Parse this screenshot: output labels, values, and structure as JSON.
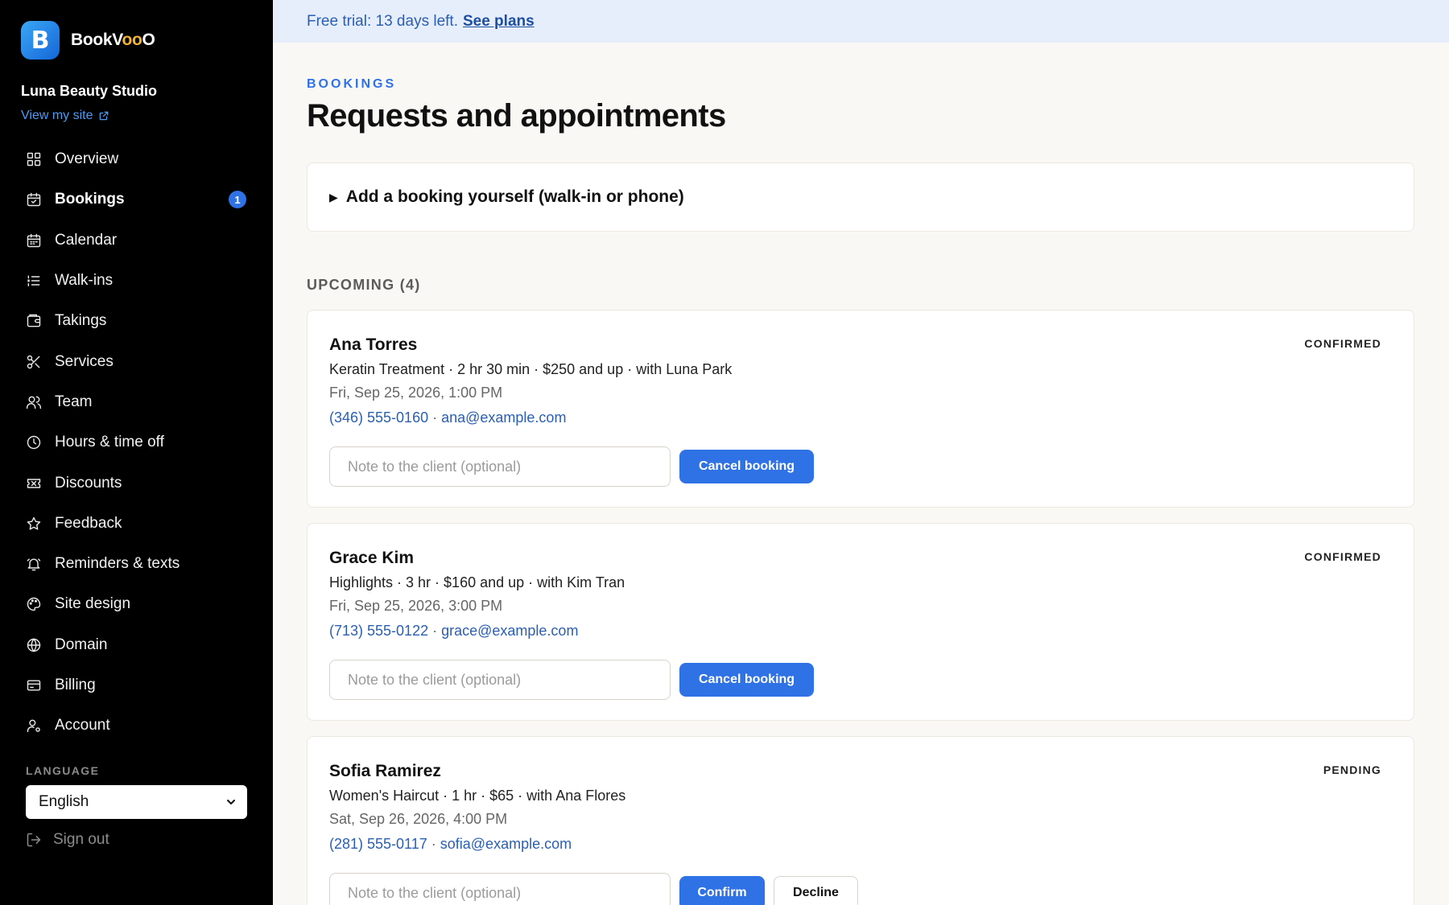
{
  "sidebar": {
    "logo_letter": "B",
    "brand_name_pre": "BookV",
    "brand_name_mid": "oo",
    "brand_name_post": "O",
    "studio_name": "Luna Beauty Studio",
    "view_site": "View my site",
    "nav": [
      {
        "label": "Overview",
        "icon": "grid-icon"
      },
      {
        "label": "Bookings",
        "icon": "calendar-check-icon",
        "badge": "1",
        "active": true
      },
      {
        "label": "Calendar",
        "icon": "calendar-icon"
      },
      {
        "label": "Walk-ins",
        "icon": "list-icon"
      },
      {
        "label": "Takings",
        "icon": "wallet-icon"
      },
      {
        "label": "Services",
        "icon": "scissors-icon"
      },
      {
        "label": "Team",
        "icon": "users-icon"
      },
      {
        "label": "Hours & time off",
        "icon": "clock-icon"
      },
      {
        "label": "Discounts",
        "icon": "ticket-icon"
      },
      {
        "label": "Feedback",
        "icon": "star-icon"
      },
      {
        "label": "Reminders & texts",
        "icon": "bell-icon"
      },
      {
        "label": "Site design",
        "icon": "palette-icon"
      },
      {
        "label": "Domain",
        "icon": "globe-icon"
      },
      {
        "label": "Billing",
        "icon": "credit-card-icon"
      },
      {
        "label": "Account",
        "icon": "user-gear-icon"
      }
    ],
    "language_label": "LANGUAGE",
    "language_value": "English",
    "sign_out": "Sign out"
  },
  "trial": {
    "text": "Free trial: 13 days left.",
    "link": "See plans"
  },
  "main": {
    "eyebrow": "BOOKINGS",
    "title": "Requests and appointments",
    "add_booking": "Add a booking yourself (walk-in or phone)",
    "upcoming_label": "UPCOMING (4)"
  },
  "bookings": [
    {
      "name": "Ana Torres",
      "detail": "Keratin Treatment · 2 hr 30 min · $250 and up · with Luna Park",
      "date": "Fri, Sep 25, 2026, 1:00 PM",
      "phone": "(346) 555-0160",
      "email": "ana@example.com",
      "status": "CONFIRMED",
      "note_placeholder": "Note to the client (optional)",
      "primary_action": "Cancel booking"
    },
    {
      "name": "Grace Kim",
      "detail": "Highlights · 3 hr · $160 and up · with Kim Tran",
      "date": "Fri, Sep 25, 2026, 3:00 PM",
      "phone": "(713) 555-0122",
      "email": "grace@example.com",
      "status": "CONFIRMED",
      "note_placeholder": "Note to the client (optional)",
      "primary_action": "Cancel booking"
    },
    {
      "name": "Sofia Ramirez",
      "detail": "Women's Haircut · 1 hr · $65 · with Ana Flores",
      "date": "Sat, Sep 26, 2026, 4:00 PM",
      "phone": "(281) 555-0117",
      "email": "sofia@example.com",
      "status": "PENDING",
      "note_placeholder": "Note to the client (optional)",
      "primary_action": "Confirm",
      "secondary_action": "Decline"
    }
  ],
  "colors": {
    "accent": "#2f72e6",
    "sidebar_bg": "#000000",
    "page_bg": "#faf8f4",
    "trial_bg": "#e6eefb"
  }
}
